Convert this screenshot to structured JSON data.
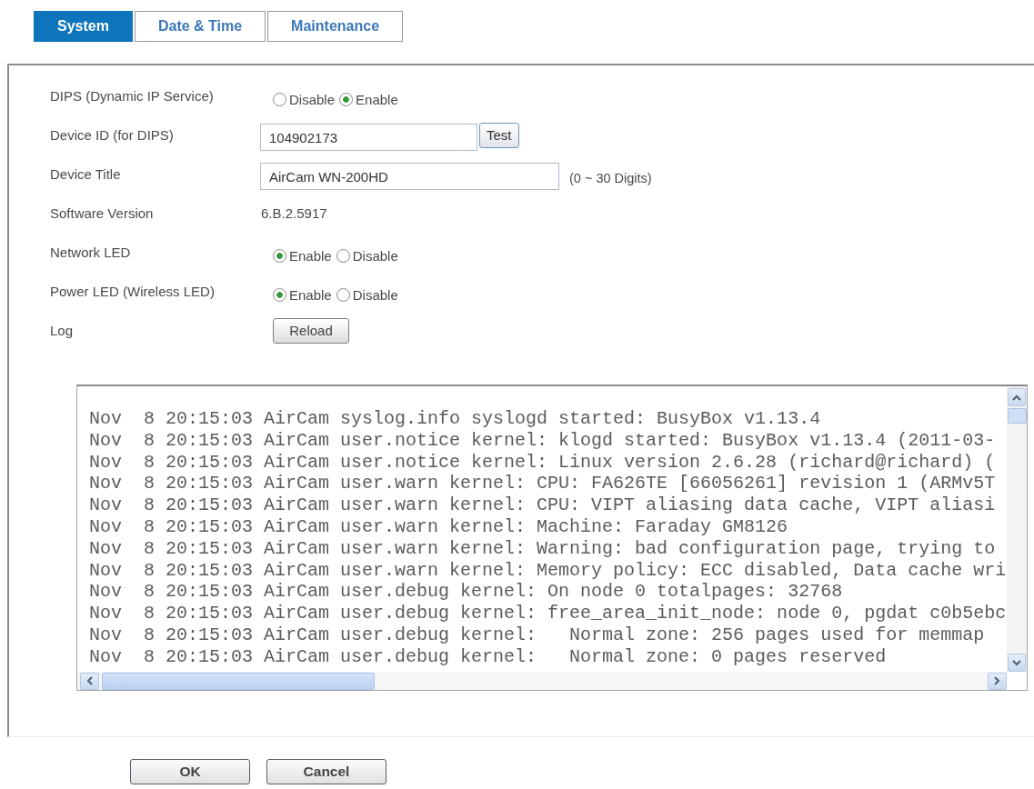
{
  "tabs": [
    {
      "label": "System",
      "selected": true
    },
    {
      "label": "Date & Time",
      "selected": false
    },
    {
      "label": "Maintenance",
      "selected": false
    }
  ],
  "settings": [
    {
      "kind": "radio",
      "label": "DIPS (Dynamic IP Service)",
      "options": [
        {
          "label": "Disable",
          "selected": false
        },
        {
          "label": "Enable",
          "selected": true
        }
      ]
    },
    {
      "kind": "input",
      "label": "Device ID (for DIPS)",
      "value": "104902173",
      "button": "Test"
    },
    {
      "kind": "input",
      "label": "Device Title",
      "value": "AirCam WN-200HD",
      "hint": "(0 ~ 30 Digits)"
    },
    {
      "kind": "text",
      "label": "Software Version",
      "value": "6.B.2.5917"
    },
    {
      "kind": "radio",
      "label": "Network LED",
      "options": [
        {
          "label": "Enable",
          "selected": true
        },
        {
          "label": "Disable",
          "selected": false
        }
      ]
    },
    {
      "kind": "radio",
      "label": "Power LED (Wireless LED)",
      "options": [
        {
          "label": "Enable",
          "selected": true
        },
        {
          "label": "Disable",
          "selected": false
        }
      ]
    },
    {
      "kind": "button",
      "label": "Log",
      "button": "Reload"
    }
  ],
  "log": {
    "lines": [
      "Nov  8 20:15:03 AirCam syslog.info syslogd started: BusyBox v1.13.4",
      "Nov  8 20:15:03 AirCam user.notice kernel: klogd started: BusyBox v1.13.4 (2011-03-",
      "Nov  8 20:15:03 AirCam user.notice kernel: Linux version 2.6.28 (richard@richard) (",
      "Nov  8 20:15:03 AirCam user.warn kernel: CPU: FA626TE [66056261] revision 1 (ARMv5T",
      "Nov  8 20:15:03 AirCam user.warn kernel: CPU: VIPT aliasing data cache, VIPT aliasi",
      "Nov  8 20:15:03 AirCam user.warn kernel: Machine: Faraday GM8126",
      "Nov  8 20:15:03 AirCam user.warn kernel: Warning: bad configuration page, trying to",
      "Nov  8 20:15:03 AirCam user.warn kernel: Memory policy: ECC disabled, Data cache wri",
      "Nov  8 20:15:03 AirCam user.debug kernel: On node 0 totalpages: 32768",
      "Nov  8 20:15:03 AirCam user.debug kernel: free_area_init_node: node 0, pgdat c0b5ebc",
      "Nov  8 20:15:03 AirCam user.debug kernel:   Normal zone: 256 pages used for memmap",
      "Nov  8 20:15:03 AirCam user.debug kernel:   Normal zone: 0 pages reserved"
    ]
  },
  "buttons": [
    "OK",
    "Cancel"
  ]
}
